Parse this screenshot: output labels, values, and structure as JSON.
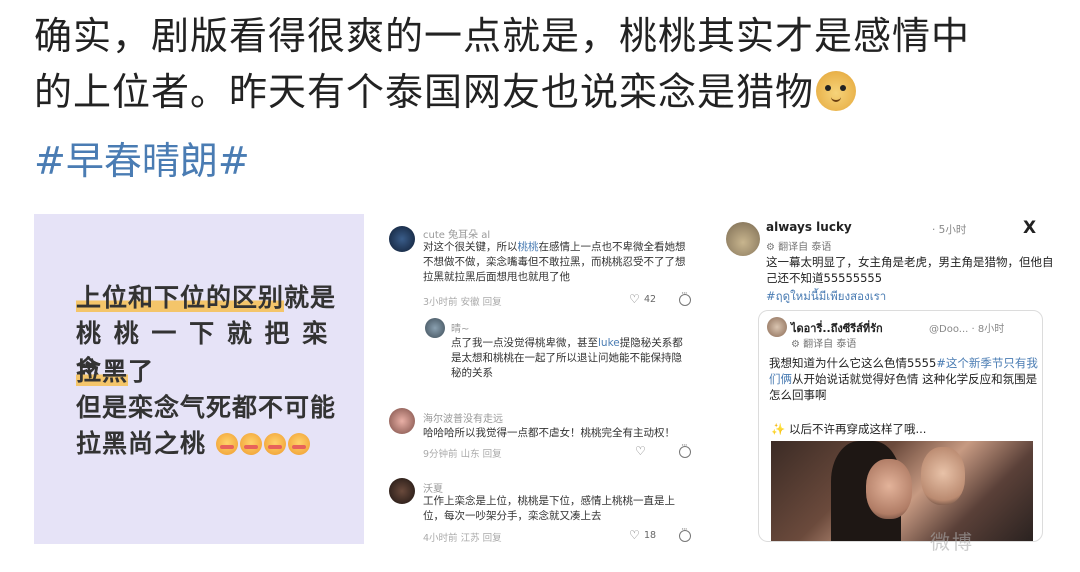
{
  "post": {
    "line1": "确实，剧版看得很爽的一点就是，桃桃其实才是感情中",
    "line2": "的上位者。昨天有个泰国网友也说栾念是猎物",
    "emoji": "doge-emoji",
    "hashtag": "#早春晴朗#"
  },
  "panel1": {
    "line1_a": "上位和下位的区别",
    "line1_b": "就是",
    "line2": "桃 桃 一 下 就 把 栾 念",
    "line3_a": "拉黑",
    "line3_b": "了",
    "line4": "但是栾念气死都不可能",
    "line5": "拉黑尚之桃"
  },
  "panel2": {
    "c1": {
      "name": "cute 兔耳朵 al",
      "body_a": "对这个很关键，所以",
      "body_link": "桃桃",
      "body_b": "在感情上一点也不卑微全看她想不想做不做，栾念嘴毒但不敢拉黑，而桃桃忍受不了了想拉黑就拉黑后面想甩也就甩了他",
      "meta": "3小时前 安徽  回复",
      "likes": "42"
    },
    "c1r": {
      "name": "晴~",
      "body_a": "点了我一点没觉得桃卑微，甚至",
      "body_link": "luke",
      "body_b": "提隐秘关系都是太想和桃桃在一起了所以退让问她能不能保持隐秘的关系"
    },
    "c2": {
      "name": "海尔波普没有走远",
      "body": "哈哈哈所以我觉得一点都不虐女！桃桃完全有主动权！",
      "meta": "9分钟前 山东  回复"
    },
    "c3": {
      "name": "沃夏",
      "body": "工作上栾念是上位，桃桃是下位，感情上桃桃一直是上位，每次一吵架分手，栾念就又凑上去",
      "meta": "4小时前 江苏  回复",
      "likes": "18"
    }
  },
  "panel3": {
    "username": "always lucky",
    "time": "· 5小时",
    "x_logo": "X",
    "translated": "翻译自 泰语",
    "body": "这一幕太明显了，女主角是老虎，男主角是猎物，但他自己还不知道55555555",
    "thai_tag": "#ฤดูใหม่นี้มีเพียงสองเรา",
    "quote": {
      "name": "ไดอารี่..ถึงซีรีส์ที่รัก",
      "handle": "@Doo... · 8小时",
      "translated": "翻译自 泰语",
      "body_a": "我想知道为什么它这么色情5555",
      "body_link": "#这个新季节只有我们俩",
      "body_b": "从开始说话就觉得好色情 这种化学反应和氛围是怎么回事啊",
      "sub": "✨ 以后不许再穿成这样了哦..."
    }
  },
  "watermark": "微博"
}
